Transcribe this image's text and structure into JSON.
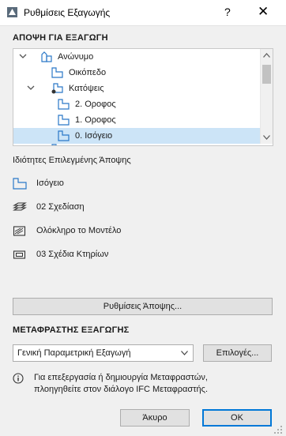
{
  "window": {
    "title": "Ρυθμίσεις Εξαγωγής",
    "help_label": "?",
    "close_label": "✕"
  },
  "view_section": {
    "heading": "ΑΠΟΨΗ ΓΙΑ ΕΞΑΓΩΓΗ",
    "tree": [
      {
        "label": "Ανώνυμο",
        "icon": "project-icon",
        "expanded": true,
        "selected": false
      },
      {
        "label": "Οικόπεδο",
        "icon": "floor-plan-icon",
        "expanded": false,
        "selected": false
      },
      {
        "label": "Κατόψεις",
        "icon": "floor-plans-folder-icon",
        "expanded": true,
        "selected": false
      },
      {
        "label": "2. Οροφος",
        "icon": "floor-plan-icon",
        "expanded": false,
        "selected": false
      },
      {
        "label": "1. Οροφος",
        "icon": "floor-plan-icon",
        "expanded": false,
        "selected": false
      },
      {
        "label": "0. Ισόγειο",
        "icon": "floor-plan-icon",
        "expanded": false,
        "selected": true
      }
    ]
  },
  "properties": {
    "heading": "Ιδιότητες Επιλεγμένης Άποψης",
    "items": [
      {
        "text": "Ισόγειο",
        "icon": "floor-plan-icon"
      },
      {
        "text": "02 Σχεδίαση",
        "icon": "layers-icon"
      },
      {
        "text": "Ολόκληρο το Μοντέλο",
        "icon": "model-filter-icon"
      },
      {
        "text": "03 Σχέδια Κτηρίων",
        "icon": "pen-set-icon"
      }
    ],
    "view_settings_button": "Ρυθμίσεις Άποψης..."
  },
  "translator": {
    "heading": "ΜΕΤΑΦΡΑΣΤΗΣ ΕΞΑΓΩΓΗΣ",
    "selected": "Γενική Παραμετρική Εξαγωγή",
    "options_button": "Επιλογές...",
    "info_line1": "Για επεξεργασία ή δημιουργία Μεταφραστών,",
    "info_line2": "πλοηγηθείτε στον διάλογο IFC Μεταφραστής."
  },
  "footer": {
    "cancel_label": "Άκυρο",
    "ok_label": "ΟΚ"
  },
  "colors": {
    "selection": "#cce4f7",
    "icon_blue": "#2a78c8",
    "primary_border": "#0078d7"
  }
}
